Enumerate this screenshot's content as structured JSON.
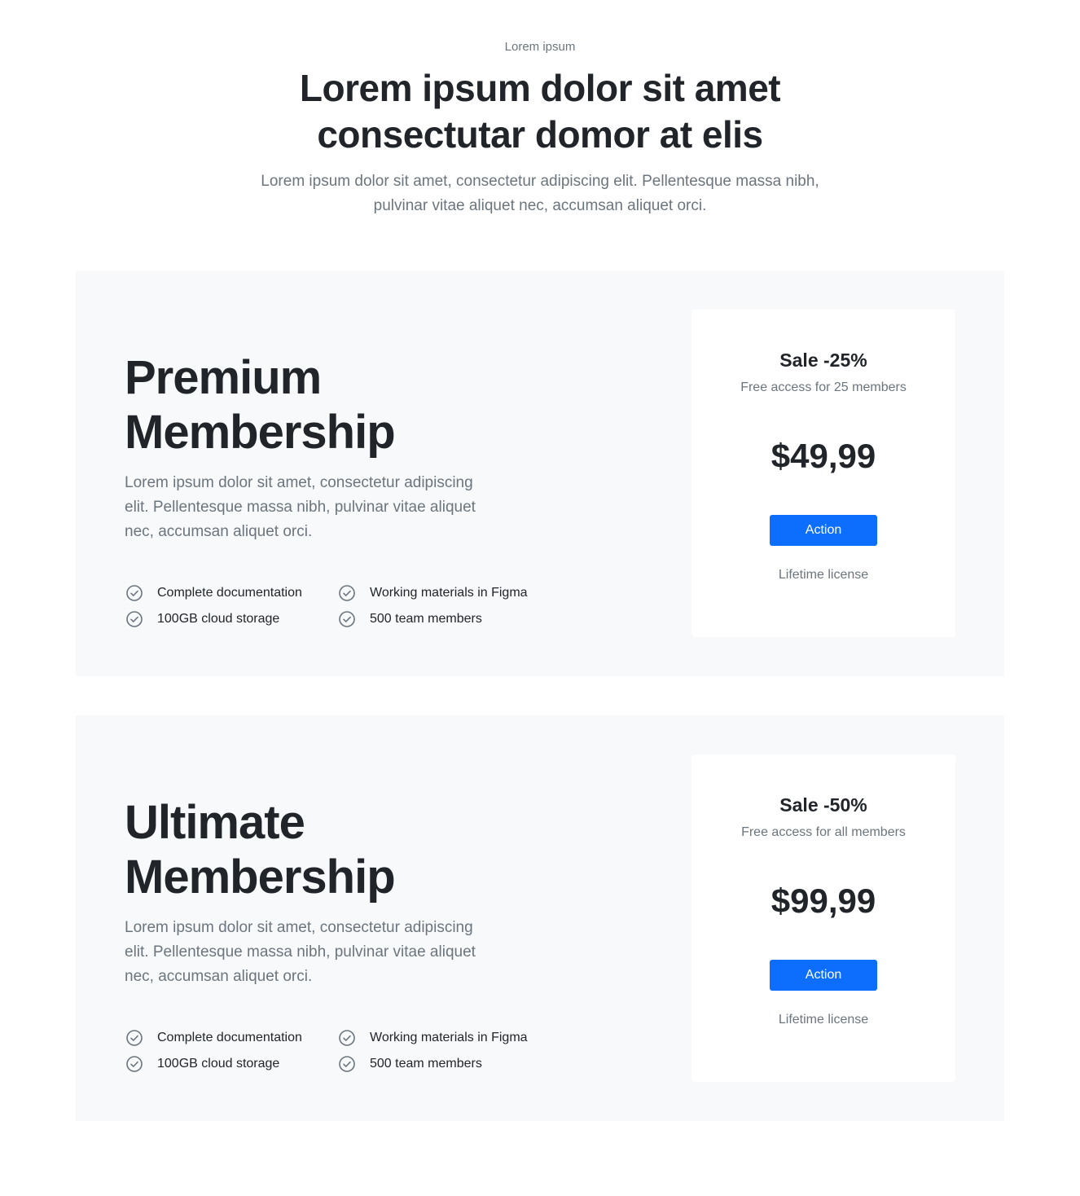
{
  "header": {
    "eyebrow": "Lorem ipsum",
    "title_line1": "Lorem ipsum dolor sit amet",
    "title_line2": "consectutar domor at elis",
    "subtitle_line1": "Lorem ipsum dolor sit amet, consectetur adipiscing elit. Pellentesque massa nibh,",
    "subtitle_line2": "pulvinar vitae aliquet nec, accumsan aliquet orci."
  },
  "plans": [
    {
      "title_line1": "Premium",
      "title_line2": "Membership",
      "desc_line1": "Lorem ipsum dolor sit amet, consectetur adipiscing",
      "desc_line2": "elit. Pellentesque massa nibh, pulvinar vitae aliquet",
      "desc_line3": "nec, accumsan aliquet orci.",
      "features": [
        "Complete documentation",
        "100GB cloud storage",
        "Working materials in Figma",
        "500 team members"
      ],
      "sale": "Sale -25%",
      "access": "Free access for 25 members",
      "price": "$49,99",
      "action_label": "Action",
      "license": "Lifetime license"
    },
    {
      "title_line1": "Ultimate",
      "title_line2": "Membership",
      "desc_line1": "Lorem ipsum dolor sit amet, consectetur adipiscing",
      "desc_line2": "elit. Pellentesque massa nibh, pulvinar vitae aliquet",
      "desc_line3": "nec, accumsan aliquet orci.",
      "features": [
        "Complete documentation",
        "100GB cloud storage",
        "Working materials in Figma",
        "500 team members"
      ],
      "sale": "Sale -50%",
      "access": "Free access for all members",
      "price": "$99,99",
      "action_label": "Action",
      "license": "Lifetime license"
    }
  ],
  "icons": {
    "feature_check": "check-circle-icon"
  },
  "colors": {
    "primary_button": "#0d6efd",
    "plan_background": "#f8f9fa",
    "card_background": "#ffffff",
    "heading_text": "#212529",
    "muted_text": "#6c757d"
  }
}
